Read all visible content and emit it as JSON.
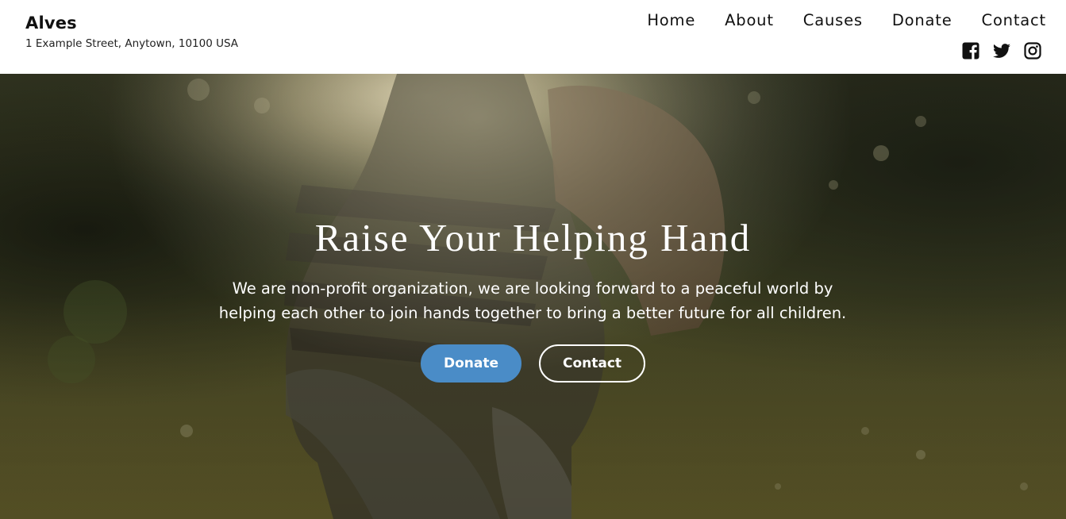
{
  "brand": {
    "name": "Alves",
    "address": "1 Example Street, Anytown, 10100 USA"
  },
  "nav": {
    "items": [
      {
        "label": "Home"
      },
      {
        "label": "About"
      },
      {
        "label": "Causes"
      },
      {
        "label": "Donate"
      },
      {
        "label": "Contact"
      }
    ]
  },
  "social": {
    "icons": [
      "facebook-square-icon",
      "twitter-icon",
      "instagram-icon"
    ]
  },
  "hero": {
    "title": "Raise Your Helping Hand",
    "text": "We are non-profit organization, we are looking forward to a peaceful world by helping each other to join hands together to bring a better future for all children.",
    "primary_button": "Donate",
    "secondary_button": "Contact"
  },
  "colors": {
    "accent": "#4a8cc7",
    "header_bg": "#ffffff",
    "hero_text": "#ffffff"
  }
}
